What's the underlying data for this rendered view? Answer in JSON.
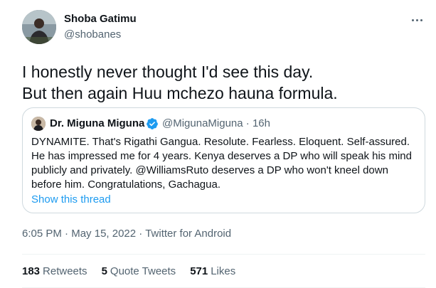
{
  "author": {
    "display_name": "Shoba Gatimu",
    "handle": "@shobanes"
  },
  "tweet": {
    "line1": "I honestly never thought I'd see this day.",
    "line2": "But then again Huu mchezo hauna formula."
  },
  "quoted_tweet": {
    "display_name": "Dr. Miguna Miguna",
    "handle": "@MigunaMiguna",
    "separator": "·",
    "age": "16h",
    "body": "DYNAMITE. That's Rigathi Gangua. Resolute. Fearless. Eloquent. Self-assured. He has impressed me for 4 years. Kenya deserves a DP who will speak his mind publicly and privately. @WilliamsRuto deserves a DP who won't kneel down before him. Congratulations, Gachagua.",
    "show_thread": "Show this thread"
  },
  "meta": {
    "time": "6:05 PM",
    "separator": "·",
    "date": "May 15, 2022",
    "source": "Twitter for Android"
  },
  "stats": {
    "retweets_count": "183",
    "retweets_label": "Retweets",
    "quotes_count": "5",
    "quotes_label": "Quote Tweets",
    "likes_count": "571",
    "likes_label": "Likes"
  },
  "colors": {
    "link_blue": "#1d9bf0",
    "secondary_text": "#536471",
    "primary_text": "#0f1419",
    "border": "#cfd9de"
  },
  "icons": {
    "more": "more-horizontal-icon",
    "verified": "verified-badge-icon"
  }
}
